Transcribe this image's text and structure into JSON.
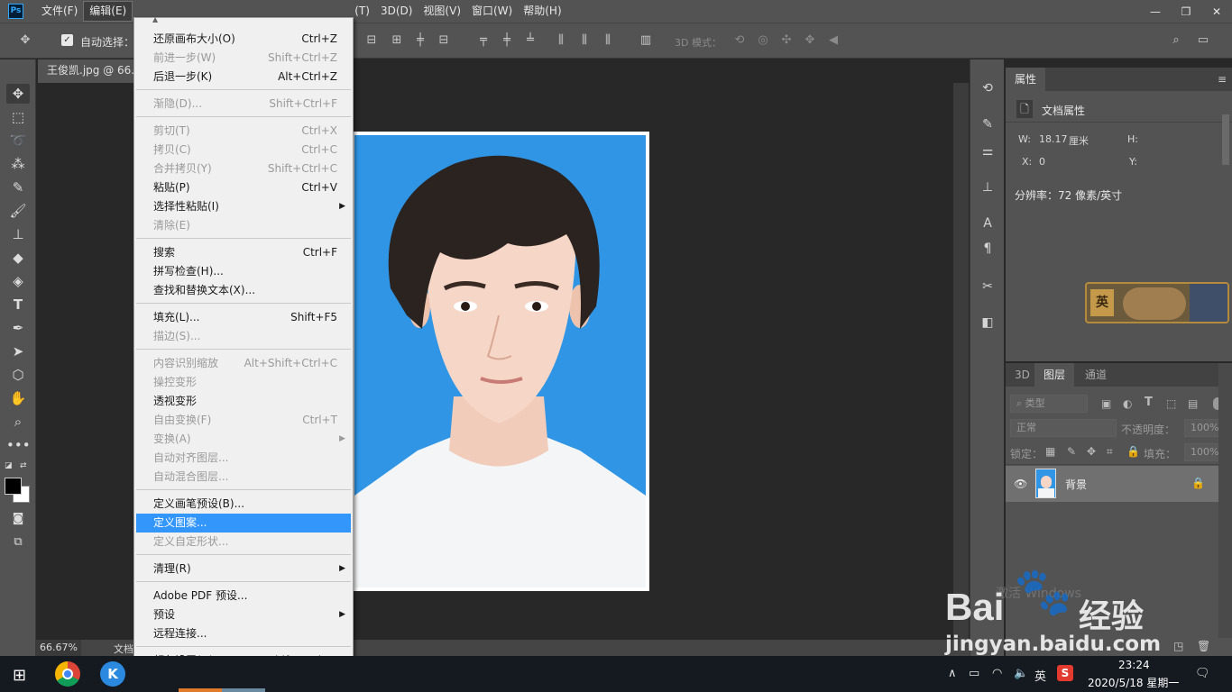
{
  "app": {
    "logo": "Ps"
  },
  "menubar": {
    "items": [
      "文件(F)",
      "编辑(E)",
      "(T)",
      "3D(D)",
      "视图(V)",
      "窗口(W)",
      "帮助(H)"
    ],
    "active": "编辑(E)"
  },
  "window_controls": {
    "minimize": "—",
    "restore": "❐",
    "close": "✕"
  },
  "optbar": {
    "auto_select_label": "自动选择：",
    "mode_3d_label": "3D 模式："
  },
  "document": {
    "tab_title": "王俊凯.jpg @ 66.7"
  },
  "statusbar": {
    "zoom": "66.67%",
    "doc_label": "文档"
  },
  "properties": {
    "tab": "属性",
    "section_title": "文档属性",
    "w_label": "W:",
    "w_value": "18.17",
    "w_unit": "厘米",
    "h_label": "H:",
    "x_label": "X:",
    "x_value": "0",
    "y_label": "Y:",
    "resolution": "分辨率：72 像素/英寸"
  },
  "layers_panel": {
    "tabs": [
      "3D",
      "图层",
      "通道"
    ],
    "active_tab": "图层",
    "filter_kind": "类型",
    "blend_mode": "正常",
    "opacity_label": "不透明度：",
    "opacity_value": "100%",
    "lock_label": "锁定：",
    "fill_label": "填充：",
    "fill_value": "100%",
    "layer_name": "背景"
  },
  "edit_menu": {
    "scroll_up": "▲",
    "scroll_down": "▼",
    "items": [
      {
        "label": "还原画布大小(O)",
        "shortcut": "Ctrl+Z",
        "disabled": false
      },
      {
        "label": "前进一步(W)",
        "shortcut": "Shift+Ctrl+Z",
        "disabled": true
      },
      {
        "label": "后退一步(K)",
        "shortcut": "Alt+Ctrl+Z",
        "disabled": false
      },
      {
        "label": "渐隐(D)...",
        "shortcut": "Shift+Ctrl+F",
        "disabled": true
      },
      {
        "label": "剪切(T)",
        "shortcut": "Ctrl+X",
        "disabled": true
      },
      {
        "label": "拷贝(C)",
        "shortcut": "Ctrl+C",
        "disabled": true
      },
      {
        "label": "合并拷贝(Y)",
        "shortcut": "Shift+Ctrl+C",
        "disabled": true
      },
      {
        "label": "粘贴(P)",
        "shortcut": "Ctrl+V",
        "disabled": false
      },
      {
        "label": "选择性粘贴(I)",
        "shortcut": "",
        "disabled": false,
        "submenu": true
      },
      {
        "label": "清除(E)",
        "shortcut": "",
        "disabled": true
      },
      {
        "label": "搜索",
        "shortcut": "Ctrl+F",
        "disabled": false
      },
      {
        "label": "拼写检查(H)...",
        "shortcut": "",
        "disabled": false
      },
      {
        "label": "查找和替换文本(X)...",
        "shortcut": "",
        "disabled": false
      },
      {
        "label": "填充(L)...",
        "shortcut": "Shift+F5",
        "disabled": false
      },
      {
        "label": "描边(S)...",
        "shortcut": "",
        "disabled": true
      },
      {
        "label": "内容识别缩放",
        "shortcut": "Alt+Shift+Ctrl+C",
        "disabled": true
      },
      {
        "label": "操控变形",
        "shortcut": "",
        "disabled": true
      },
      {
        "label": "透视变形",
        "shortcut": "",
        "disabled": false
      },
      {
        "label": "自由变换(F)",
        "shortcut": "Ctrl+T",
        "disabled": true
      },
      {
        "label": "变换(A)",
        "shortcut": "",
        "disabled": true,
        "submenu": true
      },
      {
        "label": "自动对齐图层...",
        "shortcut": "",
        "disabled": true
      },
      {
        "label": "自动混合图层...",
        "shortcut": "",
        "disabled": true
      },
      {
        "label": "定义画笔预设(B)...",
        "shortcut": "",
        "disabled": false
      },
      {
        "label": "定义图案...",
        "shortcut": "",
        "disabled": false,
        "highlighted": true
      },
      {
        "label": "定义自定形状...",
        "shortcut": "",
        "disabled": true
      },
      {
        "label": "清理(R)",
        "shortcut": "",
        "disabled": false,
        "submenu": true
      },
      {
        "label": "Adobe PDF 预设...",
        "shortcut": "",
        "disabled": false
      },
      {
        "label": "预设",
        "shortcut": "",
        "disabled": false,
        "submenu": true
      },
      {
        "label": "远程连接...",
        "shortcut": "",
        "disabled": false
      },
      {
        "label": "颜色设置(G)...",
        "shortcut": "Shift+Ctrl+K",
        "disabled": false
      }
    ]
  },
  "watermark": {
    "text_a": "Bai",
    "text_b": "经验",
    "url": "jingyan.baidu.com",
    "activate": "激活 Windows"
  },
  "taskbar": {
    "ime": "英",
    "time": "23:24",
    "date": "2020/5/18 星期一"
  }
}
